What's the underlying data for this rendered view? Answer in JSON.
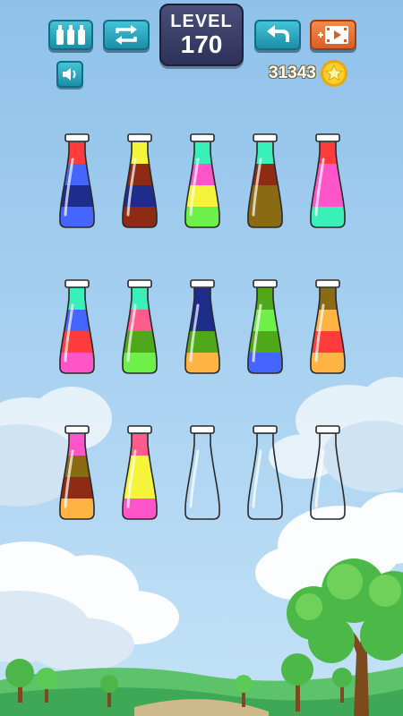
{
  "level": {
    "label": "LEVEL",
    "number": "170"
  },
  "coins": {
    "count": "31343"
  },
  "toolbar": {
    "left_buttons": [
      "bottles-icon",
      "restart-icon"
    ],
    "right_buttons": [
      "undo-icon",
      "add-bottle-video-icon"
    ],
    "sound": "speaker-icon"
  },
  "colors": {
    "red": "#ff3b3b",
    "navy": "#1e2d8c",
    "blue": "#4466ff",
    "yellow": "#f4f53a",
    "maroon": "#8e2b14",
    "mint": "#38f0b8",
    "pink": "#ff55c8",
    "lime": "#6ef04a",
    "olive": "#8b6a14",
    "rose": "#ff5b8c",
    "green": "#4fa81a",
    "orange": "#ffb444",
    "accent_teal": "#1c8ea8",
    "accent_orange": "#d95f27",
    "coin": "#f5c518"
  },
  "bottles": [
    [
      "red",
      "blue",
      "navy",
      "blue"
    ],
    [
      "yellow",
      "maroon",
      "navy",
      "maroon"
    ],
    [
      "mint",
      "pink",
      "yellow",
      "lime"
    ],
    [
      "mint",
      "maroon",
      "olive",
      "olive"
    ],
    [
      "red",
      "pink",
      "pink",
      "mint"
    ],
    [
      "mint",
      "blue",
      "red",
      "pink"
    ],
    [
      "mint",
      "rose",
      "green",
      "lime"
    ],
    [
      "navy",
      "navy",
      "green",
      "orange"
    ],
    [
      "green",
      "lime",
      "green",
      "blue"
    ],
    [
      "olive",
      "orange",
      "red",
      "orange"
    ],
    [
      "pink",
      "olive",
      "maroon",
      "orange"
    ],
    [
      "rose",
      "yellow",
      "yellow",
      "pink"
    ],
    [],
    [],
    []
  ]
}
